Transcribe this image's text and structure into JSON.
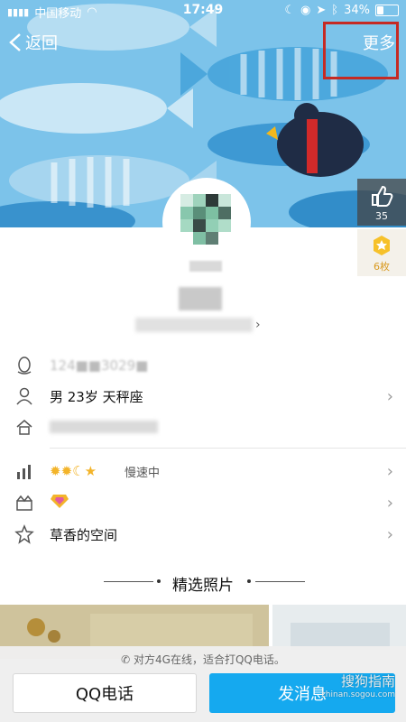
{
  "status_bar": {
    "carrier": "中国移动",
    "time": "17:49",
    "battery": "34%",
    "battery_level": 0.34
  },
  "header": {
    "back_label": "返回",
    "more_label": "更多"
  },
  "side_actions": {
    "likes": "35",
    "medals": "6枚"
  },
  "info": {
    "qq_number": "124■■3029■",
    "profile": "男 23岁 天秤座",
    "level_status": "慢速中",
    "space_label": "草香的空间"
  },
  "featured": {
    "title": "精选照片"
  },
  "bottom": {
    "online_hint": "对方4G在线，适合打QQ电话。",
    "call_button": "QQ电话",
    "message_button": "发消息",
    "watermark": "搜狗指南",
    "watermark_sub": "zhinan.sogou.com"
  },
  "colors": {
    "sky": "#6dbde8",
    "accent_blue": "#15a9ef",
    "highlight": "#c52a24"
  },
  "icons": {
    "back": "chevron-left-icon",
    "like": "thumbs-up-icon",
    "medal": "star-medal-icon",
    "qq": "qq-penguin-icon",
    "person": "person-icon",
    "home": "home-icon",
    "level": "level-chart-icon",
    "vip": "gift-icon",
    "space": "star-icon",
    "phone": "phone-icon"
  }
}
